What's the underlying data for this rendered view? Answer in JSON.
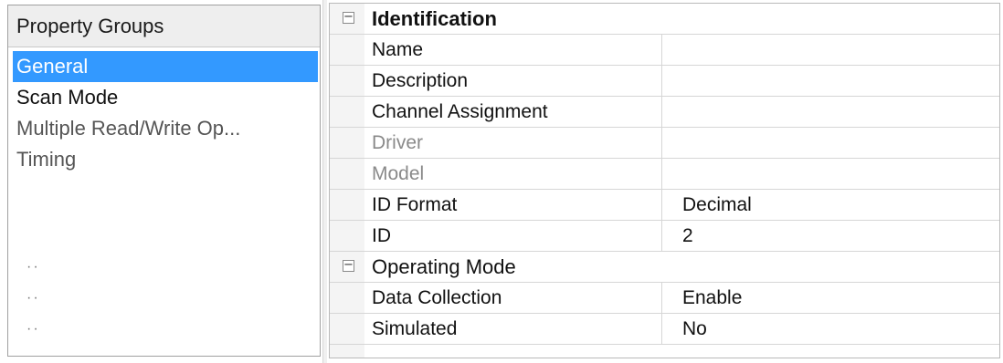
{
  "property_groups": {
    "header": "Property Groups",
    "items": [
      {
        "label": "General",
        "selected": true
      },
      {
        "label": "Scan Mode",
        "selected": false
      },
      {
        "label": "Multiple Read/Write Op...",
        "selected": false
      },
      {
        "label": "Timing",
        "selected": false
      }
    ]
  },
  "grid": {
    "categories": [
      {
        "title": "Identification",
        "rows": [
          {
            "name": "Name",
            "value": ""
          },
          {
            "name": "Description",
            "value": ""
          },
          {
            "name": "Channel Assignment",
            "value": ""
          },
          {
            "name": "Driver",
            "value": ""
          },
          {
            "name": "Model",
            "value": ""
          },
          {
            "name": "ID Format",
            "value": "Decimal"
          },
          {
            "name": "ID",
            "value": "2"
          }
        ]
      },
      {
        "title": "Operating Mode",
        "rows": [
          {
            "name": "Data Collection",
            "value": "Enable"
          },
          {
            "name": "Simulated",
            "value": "No"
          }
        ]
      }
    ]
  },
  "colors": {
    "selection": "#3399ff",
    "header_bg": "#eeeeee",
    "grid_line": "#d6d6d6"
  },
  "icons": {
    "collapse": "minus-box-icon"
  }
}
